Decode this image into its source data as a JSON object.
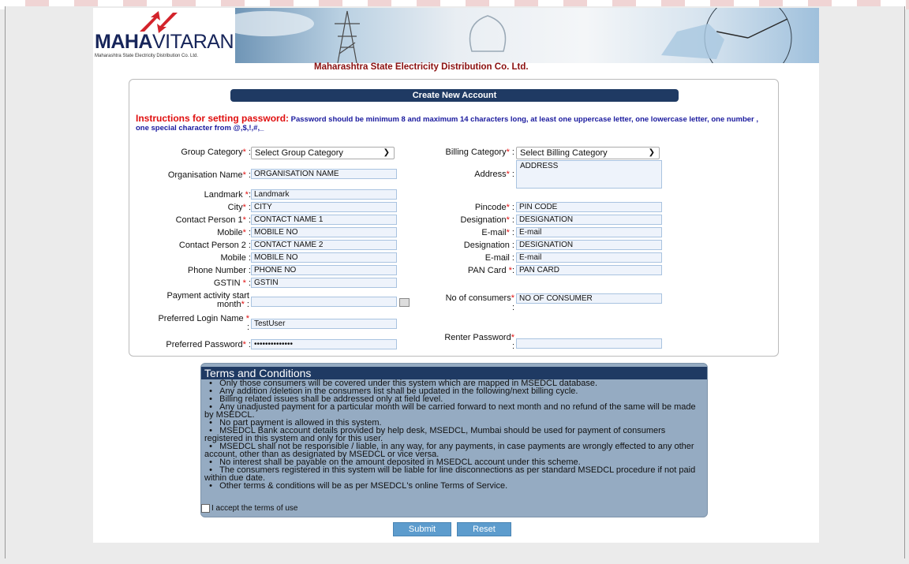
{
  "header": {
    "logo_brand_bold": "MAHA",
    "logo_brand_rest": "VITARAN",
    "logo_subtitle": "Maharashtra State Electricity Distribution Co. Ltd.",
    "company_name": "Maharashtra State Electricity Distribution Co. Ltd."
  },
  "form": {
    "title": "Create New Account",
    "instructions_label": "Instructions for setting password:",
    "instructions_text": " Password should be minimum 8 and maximum 14 characters long, at least one uppercase letter, one lowercase letter, one number , one special character from @,$,!,#,_",
    "group_category_label": "Group Category",
    "group_category_value": "Select Group Category",
    "billing_category_label": "Billing Category",
    "billing_category_value": "Select Billing Category",
    "organisation_label": "Organisation Name",
    "organisation_value": "ORGANISATION NAME",
    "address_label": "Address",
    "address_value": "ADDRESS",
    "landmark_label": "Landmark ",
    "landmark_value": "Landmark",
    "city_label": "City",
    "city_value": "CITY",
    "pincode_label": "Pincode",
    "pincode_value": "PIN CODE",
    "contact1_label": "Contact Person 1",
    "contact1_value": "CONTACT NAME 1",
    "designation1_label": "Designation",
    "designation1_value": "DESIGNATION",
    "mobile1_label": "Mobile",
    "mobile1_value": "MOBILE NO",
    "email1_label": "E-mail",
    "email1_value": "E-mail",
    "contact2_label": "Contact Person 2",
    "contact2_value": "CONTACT NAME 2",
    "designation2_label": "Designation",
    "designation2_value": "DESIGNATION",
    "mobile2_label": "Mobile",
    "mobile2_value": "MOBILE NO",
    "email2_label": "E-mail",
    "email2_value": "E-mail",
    "phone_label": "Phone Number",
    "phone_value": "PHONE NO",
    "pan_label": "PAN Card ",
    "pan_value": "PAN CARD",
    "gstin_label": "GSTIN ",
    "gstin_value": "GSTIN",
    "payment_label_line1": "Payment activity start",
    "payment_label_line2": "month",
    "payment_value": "",
    "consumers_label": "No of consumers",
    "consumers_value": "NO OF CONSUMER",
    "login_label": "Preferred Login Name ",
    "login_value": "TestUser",
    "password_label": "Preferred Password",
    "password_value": "••••••••••••••",
    "renter_label": "Renter Password",
    "renter_value": ""
  },
  "terms": {
    "title": "Terms and Conditions",
    "items": [
      "Only those consumers will be covered under this system which are mapped in MSEDCL database.",
      "Any addition /deletion in the consumers list shall be updated in the following/next billing cycle.",
      "Billing related issues shall be addressed only at field level.",
      "Any unadjusted payment for a particular month will be carried forward to next month and no refund of the same will be made by MSEDCL.",
      "No part payment is allowed in this system.",
      "MSEDCL Bank account details provided by help desk, MSEDCL, Mumbai should be used for payment of consumers registered in this system and only for this user.",
      "MSEDCL shall not be responsible / liable, in any way, for any payments, in case payments are wrongly effected to any other account, other than as designated by MSEDCL or vice versa.",
      "No interest shall be payable on the amount deposited in MSEDCL account under this scheme.",
      "The consumers registered in this system will be liable for line disconnections as per standard MSEDCL procedure if not paid within due date.",
      "Other terms & conditions will be as per MSEDCL's online Terms of Service."
    ],
    "accept_label": "I accept the terms of use"
  },
  "buttons": {
    "submit": "Submit",
    "reset": "Reset"
  },
  "colors": {
    "accent": "#1f3a63",
    "company_red": "#8b1010",
    "button_blue": "#5d9ccd",
    "terms_bg": "#95abc2"
  }
}
